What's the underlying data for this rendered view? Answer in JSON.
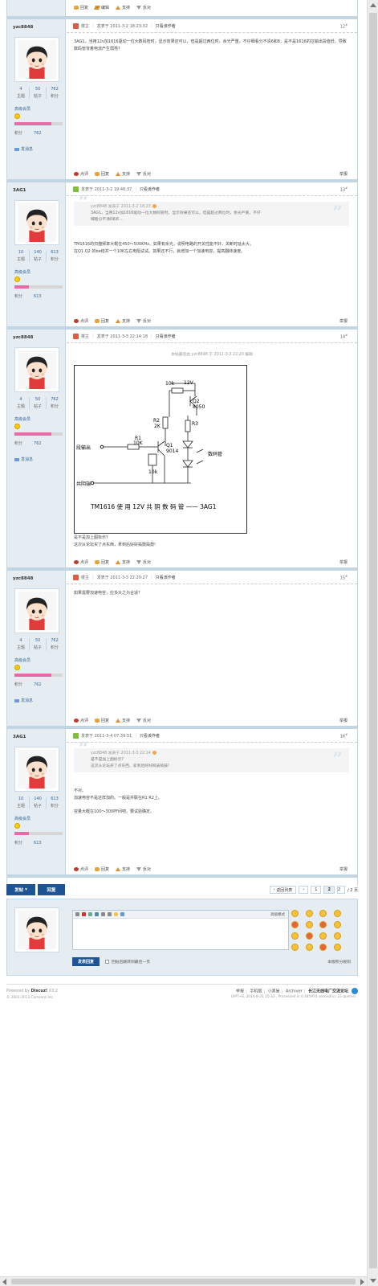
{
  "colors": {
    "border": "#c2d5e3",
    "sidebar": "#e5edf2",
    "link": "#336699",
    "button": "#1e5494",
    "points_bar": "#e86aa6"
  },
  "top_actions": {
    "reply": "回复",
    "edit": "编辑",
    "support": "支持",
    "oppose": "反对"
  },
  "labels": {
    "topics": "主题",
    "posts": "帖子",
    "credits": "积分",
    "group": "高级会员",
    "points": "积分",
    "send_msg": "发消息",
    "owner": "楼主",
    "posted_at": "发表于",
    "only_author": "只看该作者",
    "rate": "点评",
    "report": "举报"
  },
  "posts": [
    {
      "user": "yzc8848",
      "topics": "4",
      "posts_count": "50",
      "credits": "762",
      "points_val": "762",
      "points_pct": 0.76,
      "is_owner": true,
      "time": "发表于 2011-3-2 18:23:32",
      "floor": "12",
      "body": [
        "3AG1，当用12v加1616驱动一位大数码管时，显示效果还可以，但是超过两位时，余光严重，不仔细看分不清6和8，是不是1616的拉输出段值低，导致数码管背着电流产生弱亮?"
      ]
    },
    {
      "user": "3AG1",
      "topics": "10",
      "posts_count": "140",
      "credits": "613",
      "points_val": "613",
      "points_pct": 0.3,
      "is_owner": false,
      "time": "发表于 2011-3-2 19:46:37",
      "floor": "13",
      "quote": {
        "author": "yzc8848 发表于 2011-3-2 18:23",
        "lines": [
          "3AG1，当用12v加1616驱动一位大数码管时，显示效果还可以，但是超过两位时，余光严重，不仔",
          "细看分不清6和8 ..."
        ]
      },
      "body": [
        "TM1616的扫描频率大概在450～500KHz。如果有余光，说明电路的开关性能不好，关断时延太大。",
        "在Q1 Q2 的be结并一个10K左右电阻试试。如果还不行，就增加一个加速电容，提高翻转速度。"
      ]
    },
    {
      "user": "yzc8848",
      "topics": "4",
      "posts_count": "50",
      "credits": "762",
      "points_val": "762",
      "points_pct": 0.76,
      "is_owner": true,
      "time": "发表于 2011-3-3 22:14:18",
      "floor": "14",
      "edit_note": "本帖最后由 yzc8848 于 2011-3-3 22:20 编辑",
      "diagram": {
        "top_r": "10k",
        "vcc": "12V",
        "q2": "Q2",
        "q2_part": "8050",
        "r2": "R2",
        "r2_val": "2K",
        "r3": "R3",
        "r1": "R1",
        "r1_val": "10K",
        "q1": "Q1",
        "q1_part": "9014",
        "r_bottom": "10k",
        "seg_out": "段输出",
        "digit": "数码管",
        "common": "共阴端",
        "caption": "TM1616 使 用 12V 共 阴 数 码 管 —— 3AG1"
      },
      "body": [
        "是不是加上图标示?",
        "这次从论坛买了点东西，拿到后好好捣鼓捣鼓!"
      ]
    },
    {
      "user": "yzc8848",
      "topics": "4",
      "posts_count": "50",
      "credits": "762",
      "points_val": "762",
      "points_pct": 0.76,
      "is_owner": true,
      "time": "发表于 2011-3-3 22:20:27",
      "floor": "15",
      "body": [
        "如果需要加速电容，应多大之为合适？"
      ]
    },
    {
      "user": "3AG1",
      "topics": "10",
      "posts_count": "140",
      "credits": "613",
      "points_val": "613",
      "points_pct": 0.3,
      "is_owner": false,
      "time": "发表于 2011-3-4 07:39:51",
      "floor": "16",
      "quote": {
        "author": "yzc8848 发表于 2011-3-3 22:14",
        "lines": [
          "是不是加上图标示?",
          "这次从论坛买了点东西，拿到后好好捣鼓捣鼓!"
        ]
      },
      "body": [
        "不对。",
        "加速电容不是这样加的。一般是并联在R1 R2上。",
        "",
        "容量大概在100～300PF间吧。要试验确定。"
      ]
    }
  ],
  "pager": {
    "post": "发帖",
    "reply": "回复",
    "back": "返回列表",
    "prev": "‹",
    "p1": "1",
    "p2": "2",
    "input": "2",
    "total": "/ 2 页"
  },
  "fastpost": {
    "advanced": "高级模式",
    "submit": "发表回复",
    "checkbox": "回帖后跳转到最后一页",
    "rule": "本版积分规则"
  },
  "footer": {
    "powered": "Powered by",
    "brand": "Discuz!",
    "version": " X3.2",
    "copyright": "© 2001-2013 Comsenz Inc.",
    "links": [
      "举报",
      "手机版",
      "小黑屋",
      "Archiver"
    ],
    "site": "长江无线电厂交流论坛",
    "gmt": "GMT+8, 2014-8-21 10:33 , Processed in 0.185974 second(s), 23 queries ."
  }
}
